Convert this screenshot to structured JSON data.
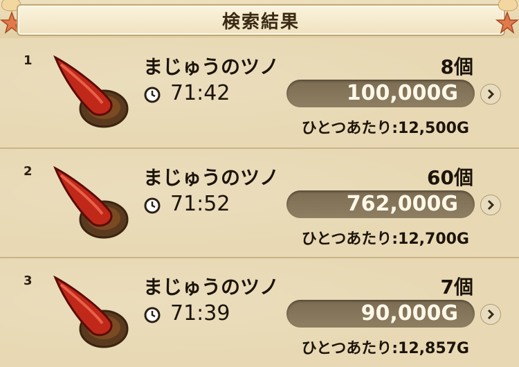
{
  "header": {
    "title": "検索結果"
  },
  "results": [
    {
      "index": "1",
      "name": "まじゅうのツノ",
      "quantity": "8個",
      "time": "71:42",
      "price": "100,000G",
      "unit_price": "ひとつあたり:12,500G"
    },
    {
      "index": "2",
      "name": "まじゅうのツノ",
      "quantity": "60個",
      "time": "71:52",
      "price": "762,000G",
      "unit_price": "ひとつあたり:12,700G"
    },
    {
      "index": "3",
      "name": "まじゅうのツノ",
      "quantity": "7個",
      "time": "71:39",
      "price": "90,000G",
      "unit_price": "ひとつあたり:12,857G"
    }
  ],
  "colors": {
    "pill": "#847458",
    "background": "#e8d9b4",
    "horn": "#c0281a"
  },
  "icons": {
    "item": "horn-icon",
    "clock": "clock-icon",
    "arrow": "chevron-right-icon"
  }
}
